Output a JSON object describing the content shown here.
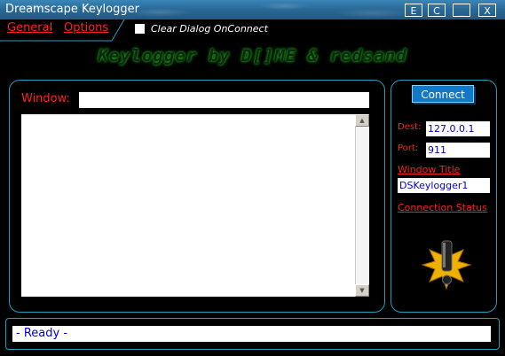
{
  "window": {
    "title": "Dreamscape Keylogger",
    "buttons": [
      "E",
      "C",
      "_",
      "X"
    ]
  },
  "tabs": [
    {
      "label": "General"
    },
    {
      "label": "Options"
    }
  ],
  "clear_dialog": {
    "label": "Clear Dialog OnConnect",
    "checked": false
  },
  "banner": "Keylogger by D[]ME & redsand",
  "capture": {
    "window_label": "Window:",
    "window_value": "",
    "log_text": ""
  },
  "connection": {
    "connect_label": "Connect",
    "dest_label": "Dest:",
    "dest_value": "127.0.0.1",
    "port_label": "Port:",
    "port_value": "911",
    "window_title_label": "Window Title",
    "window_title_value": "DSKeylogger1",
    "status_label": "Connection Status"
  },
  "status": {
    "text": "- Ready -"
  },
  "colors": {
    "accent_red": "#ff2020",
    "panel_border": "#22a0b8",
    "value_blue": "#0000cc",
    "connect_blue": "#1478c8"
  },
  "icons": {
    "status_indicator": "exclamation-starburst-icon"
  }
}
